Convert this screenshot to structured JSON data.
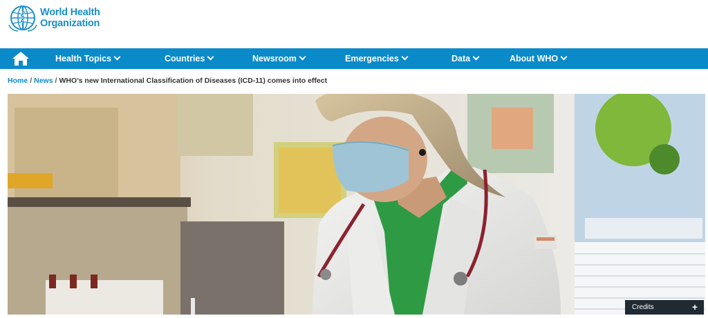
{
  "header": {
    "logo_line1": "World Health",
    "logo_line2": "Organization"
  },
  "nav": {
    "home_icon": "home-icon",
    "items": [
      {
        "label": "Health Topics"
      },
      {
        "label": "Countries"
      },
      {
        "label": "Newsroom"
      },
      {
        "label": "Emergencies"
      },
      {
        "label": "Data"
      },
      {
        "label": "About WHO"
      }
    ]
  },
  "breadcrumb": {
    "home": "Home",
    "news": "News",
    "current": "WHO’s new International Classification of Diseases (ICD-11) comes into effect"
  },
  "hero": {
    "credits_label": "Credits",
    "credits_toggle": "+"
  },
  "colors": {
    "brand_blue": "#0b8ac9",
    "nav_text": "#ffffff",
    "credits_bg": "#1f2a33"
  }
}
